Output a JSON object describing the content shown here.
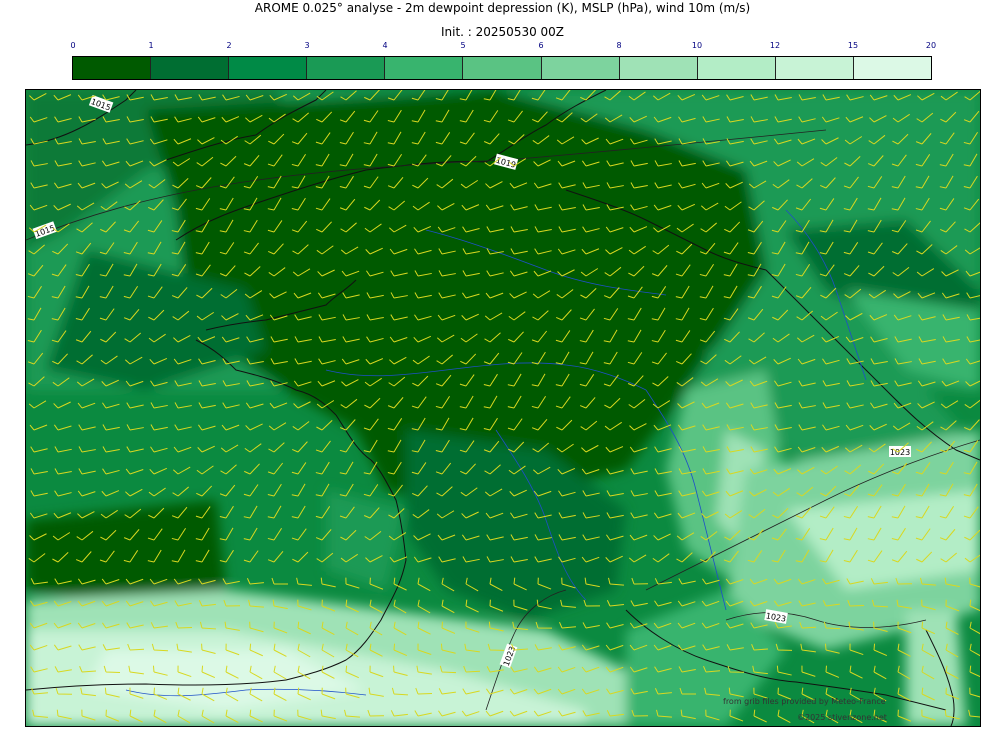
{
  "header": {
    "title": "AROME 0.025° analyse - 2m dewpoint depression (K), MSLP (hPa), wind 10m (m/s)",
    "init": "Init. : 20250530 00Z"
  },
  "colorbar": {
    "ticks": [
      "0",
      "1",
      "2",
      "3",
      "4",
      "5",
      "6",
      "8",
      "10",
      "12",
      "15",
      "20"
    ],
    "colors": [
      "#005a00",
      "#006e32",
      "#008a46",
      "#1a9a55",
      "#38b46e",
      "#5ac383",
      "#7dd39e",
      "#9fe2b6",
      "#b3edc6",
      "#c8f3d6",
      "#dcf9e6"
    ]
  },
  "isobars": {
    "labels": [
      "1015",
      "1019",
      "1015",
      "1023",
      "1023",
      "1023"
    ]
  },
  "credits": {
    "source": "from grib files provided by Meteo-France",
    "copyright": "©2025 stivenzone.net"
  },
  "colors": {
    "coast": "#111111",
    "river": "#1e50c8",
    "barb": "#d8d820"
  }
}
